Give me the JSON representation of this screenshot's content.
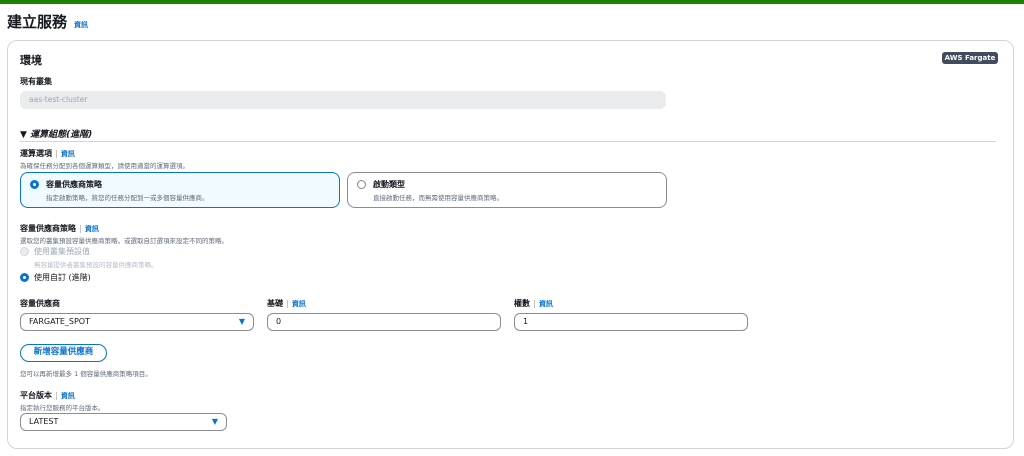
{
  "page": {
    "title": "建立服務",
    "info": "資訊"
  },
  "env": {
    "heading": "環境",
    "badge": "AWS Fargate",
    "cluster_label": "現有叢集",
    "cluster_value": "aas-test-cluster",
    "compute_toggle": "運算組態(進階)",
    "compute_options_label": "運算選項",
    "compute_options_info": "資訊",
    "compute_options_desc": "為確保任務分配到各個運算類型，請使用適當的運算選項。",
    "option_capacity_title": "容量供應商策略",
    "option_capacity_desc": "指定啟動策略，將您的任務分配到一或多個容量供應商。",
    "option_launch_title": "啟動類型",
    "option_launch_desc": "直接啟動任務，而無需使用容量供應商策略。",
    "strategy_label": "容量供應商策略",
    "strategy_info": "資訊",
    "strategy_desc": "選取您的叢集預設容量供應商策略，或選取自訂選項來設定不同的策略。",
    "use_default_label": "使用叢集預設值",
    "use_default_desc": "無容量提供者叢集預設的容量供應商策略。",
    "use_custom_label": "使用自訂 (進階)",
    "provider_label": "容量供應商",
    "provider_value": "FARGATE_SPOT",
    "base_label": "基礎",
    "base_info": "資訊",
    "base_value": "0",
    "weight_label": "權數",
    "weight_info": "資訊",
    "weight_value": "1",
    "add_provider_button": "新增容量供應商",
    "add_provider_note": "您可以再新增最多 1 個容量供應商策略項目。",
    "platform_label": "平台版本",
    "platform_info": "資訊",
    "platform_desc": "指定執行您服務的平台版本。",
    "platform_value": "LATEST"
  },
  "colors": {
    "accent": "#0972d3",
    "success_bar": "#1d8102",
    "badge_bg": "#414d5c"
  }
}
